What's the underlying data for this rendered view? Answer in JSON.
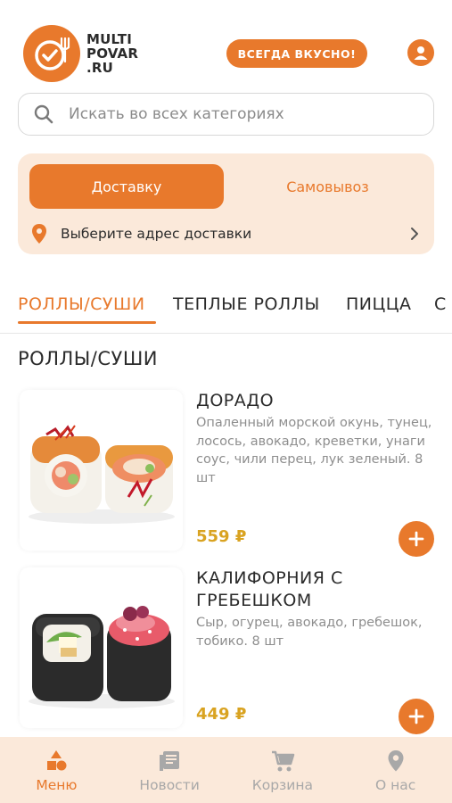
{
  "header": {
    "logo_text": "MULTI\nPOVAR\n.RU",
    "tagline": "ВСЕГДА ВКУСНО!",
    "brand_color": "#e8792c",
    "icons": [
      "logo-plate-icon",
      "profile-icon"
    ]
  },
  "search": {
    "placeholder": "Искать во всех категориях",
    "icon": "search-icon"
  },
  "delivery": {
    "delivery_label": "Доставку",
    "pickup_label": "Самовывоз",
    "address_label": "Выберите адрес доставки",
    "icons": [
      "location-pin-icon",
      "chevron-right-icon"
    ]
  },
  "tabs": [
    {
      "label": "РОЛЛЫ/СУШИ",
      "active": true
    },
    {
      "label": "ТЕПЛЫЕ РОЛЛЫ",
      "active": false
    },
    {
      "label": "ПИЦЦА",
      "active": false
    },
    {
      "label": "С",
      "active": false
    }
  ],
  "section": {
    "title": "РОЛЛЫ/СУШИ"
  },
  "products": [
    {
      "name": "ДОРАДО",
      "description": "Опаленный морской окунь, тунец, лосось, авокадо, креветки, унаги соус, чили перец, лук зеленый. 8 шт",
      "price": "559 ₽"
    },
    {
      "name": "КАЛИФОРНИЯ С ГРЕБЕШКОМ",
      "description": "Сыр, огурец, авокадо, гребешок, тобико. 8 шт",
      "price": "449 ₽"
    }
  ],
  "bottom_nav": [
    {
      "label": "Меню",
      "icon": "menu-shapes-icon",
      "active": true
    },
    {
      "label": "Новости",
      "icon": "news-icon",
      "active": false
    },
    {
      "label": "Корзина",
      "icon": "cart-icon",
      "active": false
    },
    {
      "label": "О нас",
      "icon": "location-pin-icon",
      "active": false
    }
  ],
  "colors": {
    "accent": "#e8792c",
    "accent_light": "#fbe9da",
    "price": "#d9a321",
    "muted": "#8e8e8e"
  }
}
